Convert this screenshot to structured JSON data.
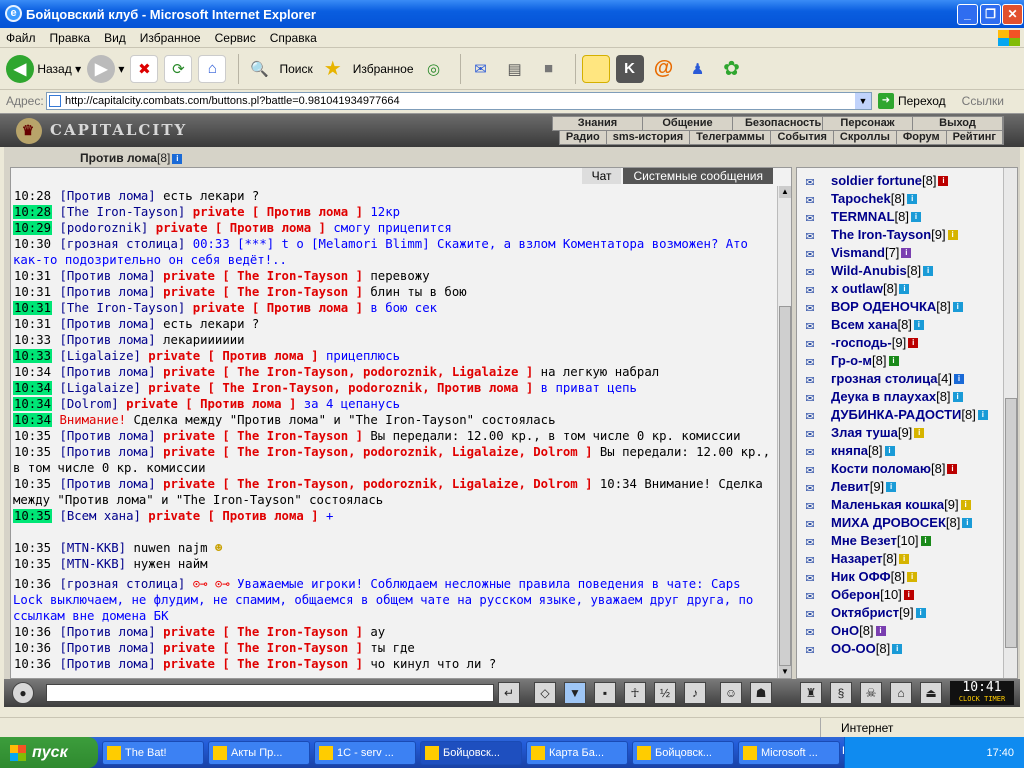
{
  "window": {
    "title": "Бойцовский клуб - Microsoft Internet Explorer"
  },
  "menu": [
    "Файл",
    "Правка",
    "Вид",
    "Избранное",
    "Сервис",
    "Справка"
  ],
  "toolbar": {
    "back": "Назад",
    "search": "Поиск",
    "favorites": "Избранное"
  },
  "address": {
    "label": "Адрес:",
    "url": "http://capitalcity.combats.com/buttons.pl?battle=0.981041934977664",
    "go": "Переход",
    "links": "Ссылки"
  },
  "game": {
    "logo": "CAPITALCITY",
    "nav1": [
      "Знания",
      "Общение",
      "Безопасность",
      "Персонаж",
      "Выход"
    ],
    "nav2": [
      "Радио",
      "sms-история",
      "Телеграммы",
      "События",
      "Скроллы",
      "Форум",
      "Рейтинг"
    ],
    "room_user": "Против лома",
    "room_level": "[8]"
  },
  "tabs": {
    "chat": "Чат",
    "system": "Системные сообщения"
  },
  "chat": [
    {
      "t": "10:28",
      "hl": false,
      "from": "[Против лома]",
      "priv": "",
      "text": "есть лекари ?",
      "cls": "sys"
    },
    {
      "t": "10:28",
      "hl": true,
      "from": "[The Iron-Tayson]",
      "priv": "private [ Против лома ]",
      "text": "12кр",
      "cls": "privmsg"
    },
    {
      "t": "10:29",
      "hl": true,
      "from": "[podoroznik]",
      "priv": "private [ Против лома ]",
      "text": "смогу прицепится",
      "cls": "privmsg"
    },
    {
      "t": "10:30",
      "hl": false,
      "from": "[грозная столица]",
      "priv": "",
      "text": "00:33 [***] t o [Melamori Blimm] Скажите, а взлом Коментатора возможен? Ато как-то подозрительно он себя ведёт!..",
      "cls": "privmsg",
      "wrap": true
    },
    {
      "t": "10:31",
      "hl": false,
      "from": "[Против лома]",
      "priv": "private [ The Iron-Tayson ]",
      "text": "перевожу",
      "cls": "sys"
    },
    {
      "t": "10:31",
      "hl": false,
      "from": "[Против лома]",
      "priv": "private [ The Iron-Tayson ]",
      "text": "блин ты в бою",
      "cls": "sys"
    },
    {
      "t": "10:31",
      "hl": true,
      "from": "[The Iron-Tayson]",
      "priv": "private [ Против лома ]",
      "text": "в бою сек",
      "cls": "privmsg"
    },
    {
      "t": "10:31",
      "hl": false,
      "from": "[Против лома]",
      "priv": "",
      "text": "есть лекари ?",
      "cls": "sys"
    },
    {
      "t": "10:33",
      "hl": false,
      "from": "[Против лома]",
      "priv": "",
      "text": "лекарииииии",
      "cls": "sys"
    },
    {
      "t": "10:33",
      "hl": true,
      "from": "[Ligalaize]",
      "priv": "private [ Против лома ]",
      "text": "прицеплюсь",
      "cls": "privmsg"
    },
    {
      "t": "10:34",
      "hl": false,
      "from": "[Против лома]",
      "priv": "private [ The Iron-Tayson, podoroznik, Ligalaize ]",
      "text": "на легкую набрал",
      "cls": "sys"
    },
    {
      "t": "10:34",
      "hl": true,
      "from": "[Ligalaize]",
      "priv": "private [ The Iron-Tayson, podoroznik, Против лома ]",
      "text": "в приват цепь",
      "cls": "privmsg"
    },
    {
      "t": "10:34",
      "hl": true,
      "from": "[Dolrom]",
      "priv": "private [ Против лома ]",
      "text": "за 4 цепанусь",
      "cls": "privmsg"
    },
    {
      "t": "10:34",
      "hl": true,
      "from": "",
      "priv": "",
      "warn": "Внимание!",
      "text": "Сделка между \"Против лома\" и \"The Iron-Tayson\" состоялась",
      "cls": "sys"
    },
    {
      "t": "10:35",
      "hl": false,
      "from": "[Против лома]",
      "priv": "private [ The Iron-Tayson ]",
      "text": "Вы передали: 12.00 кр., в том числе 0 кр. комиссии",
      "cls": "sys"
    },
    {
      "t": "10:35",
      "hl": false,
      "from": "[Против лома]",
      "priv": "private [ The Iron-Tayson, podoroznik, Ligalaize, Dolrom ]",
      "text": "Вы передали: 12.00 кр., в том числе 0 кр. комиссии",
      "cls": "sys",
      "wrap": true
    },
    {
      "t": "10:35",
      "hl": false,
      "from": "[Против лома]",
      "priv": "private [ The Iron-Tayson, podoroznik, Ligalaize, Dolrom ]",
      "text": "10:34 Внимание! Сделка между \"Против лома\" и \"The Iron-Tayson\" состоялась",
      "cls": "sys",
      "wrap": true
    },
    {
      "t": "10:35",
      "hl": true,
      "from": "[Всем хана]",
      "priv": "private [ Против лома ]",
      "text": "+",
      "cls": "privmsg"
    },
    {
      "t": "",
      "hl": false,
      "from": "",
      "priv": "",
      "text": "",
      "cls": "sys",
      "spacer": true
    },
    {
      "t": "10:35",
      "hl": false,
      "from": "[MTN-KKB]",
      "priv": "",
      "text": "nuwen najm",
      "cls": "sys",
      "smiley": true
    },
    {
      "t": "10:35",
      "hl": false,
      "from": "[MTN-KKB]",
      "priv": "",
      "text": "нужен найм",
      "cls": "sys"
    },
    {
      "t": "10:36",
      "hl": false,
      "from": "[грозная столица]",
      "priv": "",
      "text": "Уважаемые игроки! Соблюдаем несложные правила поведения в чате: Caps Lock выключаем, не флудим, не спамим, общаемся в общем чате на русском языке, уважаем друг друга, по ссылкам вне домена БК",
      "cls": "privmsg",
      "wrap": true,
      "pad": true
    },
    {
      "t": "10:36",
      "hl": false,
      "from": "[Против лома]",
      "priv": "private [ The Iron-Tayson ]",
      "text": "ау",
      "cls": "sys"
    },
    {
      "t": "10:36",
      "hl": false,
      "from": "[Против лома]",
      "priv": "private [ The Iron-Tayson ]",
      "text": "ты где",
      "cls": "sys"
    },
    {
      "t": "10:36",
      "hl": false,
      "from": "[Против лома]",
      "priv": "private [ The Iron-Tayson ]",
      "text": "чо кинул что ли ?",
      "cls": "sys"
    }
  ],
  "users": [
    {
      "name": "soldier fortune",
      "level": "[8]",
      "c": "#b00"
    },
    {
      "name": "Tapochek",
      "level": "[8]",
      "c": "#1a9bd7"
    },
    {
      "name": "TERMNAL",
      "level": "[8]",
      "c": "#1a9bd7"
    },
    {
      "name": "The Iron-Tayson",
      "level": "[9]",
      "c": "#d6b400"
    },
    {
      "name": "Vismand",
      "level": "[7]",
      "c": "#7a3fb0"
    },
    {
      "name": "Wild-Anubis",
      "level": "[8]",
      "c": "#1a9bd7"
    },
    {
      "name": "x outlaw",
      "level": "[8]",
      "c": "#1a9bd7"
    },
    {
      "name": "ВОР ОДЕНОЧКА",
      "level": "[8]",
      "c": "#1a9bd7"
    },
    {
      "name": "Всем хана",
      "level": "[8]",
      "c": "#1a9bd7"
    },
    {
      "name": "-господь-",
      "level": "[9]",
      "c": "#b00"
    },
    {
      "name": "Гр-о-м",
      "level": "[8]",
      "c": "#1a8a1a"
    },
    {
      "name": "грозная столица",
      "level": "[4]",
      "c": "#1a6ad7"
    },
    {
      "name": "Деука в плаухах",
      "level": "[8]",
      "c": "#1a9bd7"
    },
    {
      "name": "ДУБИНКА-РАДОСТИ",
      "level": "[8]",
      "c": "#1a9bd7"
    },
    {
      "name": "Злая туша",
      "level": "[9]",
      "c": "#d6b400"
    },
    {
      "name": "княпа",
      "level": "[8]",
      "c": "#1a9bd7"
    },
    {
      "name": "Кости поломаю",
      "level": "[8]",
      "c": "#b00"
    },
    {
      "name": "Левит",
      "level": "[9]",
      "c": "#1a9bd7"
    },
    {
      "name": "Маленькая кошка",
      "level": "[9]",
      "c": "#d6b400"
    },
    {
      "name": "МИХА ДРОВОСЕК",
      "level": "[8]",
      "c": "#1a9bd7"
    },
    {
      "name": "Мне Везет",
      "level": "[10]",
      "c": "#1a8a1a"
    },
    {
      "name": "Назарет",
      "level": "[8]",
      "c": "#d6b400"
    },
    {
      "name": "Ник ОФФ",
      "level": "[8]",
      "c": "#d6b400"
    },
    {
      "name": "Оберон",
      "level": "[10]",
      "c": "#b00"
    },
    {
      "name": "Октябрист",
      "level": "[9]",
      "c": "#1a9bd7"
    },
    {
      "name": "ОнО",
      "level": "[8]",
      "c": "#7a3fb0"
    },
    {
      "name": "ОО-ОО",
      "level": "[8]",
      "c": "#1a9bd7"
    }
  ],
  "clock": {
    "time": "10:41",
    "label1": "CLOCK",
    "label2": "TIMER"
  },
  "status": {
    "zone": "Интернет"
  },
  "taskbar": {
    "start": "пуск",
    "tasks": [
      "The Bat!",
      "Акты Пр...",
      "1C - serv ...",
      "Бойцовск...",
      "Карта Ба...",
      "Бойцовск...",
      "Microsoft ..."
    ],
    "active_index": 3,
    "lang": "RU",
    "time": "17:40"
  }
}
